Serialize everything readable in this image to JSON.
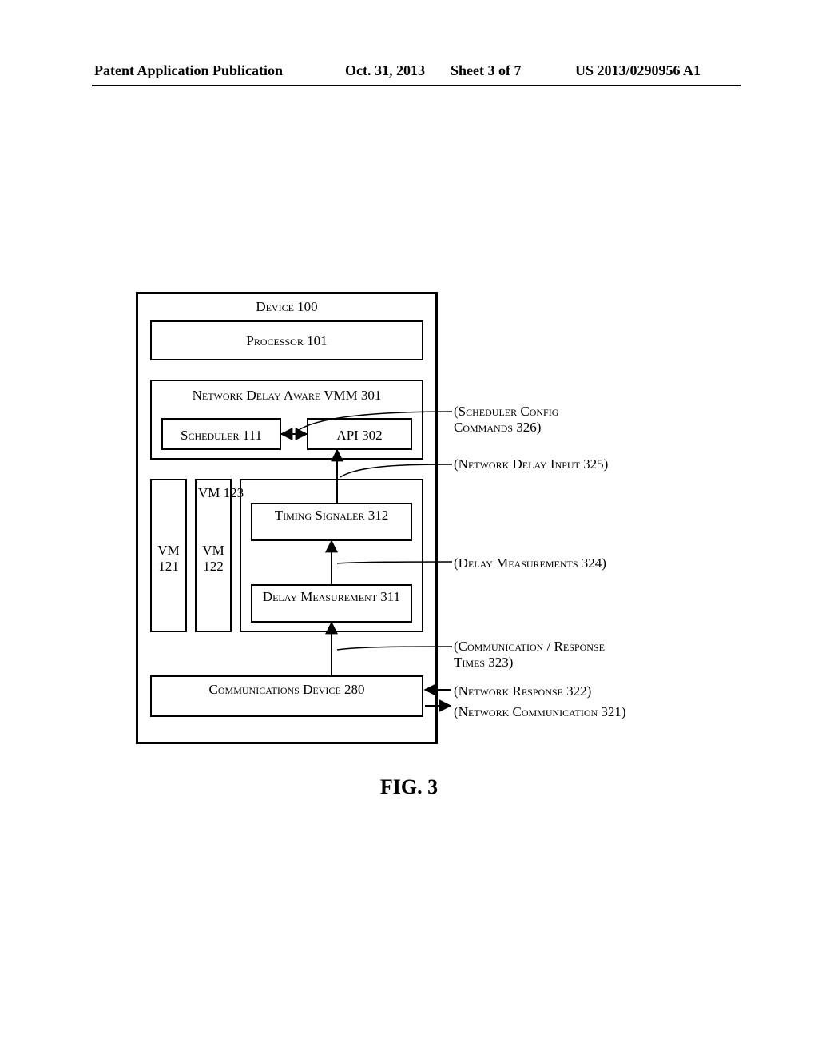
{
  "header": {
    "publication": "Patent Application Publication",
    "date": "Oct. 31, 2013",
    "sheet": "Sheet 3 of 7",
    "pubno": "US 2013/0290956 A1"
  },
  "device": {
    "title": "Device 100",
    "processor": "Processor 101",
    "vmm": {
      "title": "Network Delay Aware VMM 301",
      "scheduler": "Scheduler 111",
      "api": "API 302"
    },
    "vms": {
      "vm121": "VM 121",
      "vm122": "VM 122",
      "vm123": {
        "title": "VM 123",
        "signaler": "Timing Signaler 312",
        "measurement": "Delay Measurement 311"
      }
    },
    "comm": "Communications Device 280"
  },
  "annotations": {
    "a326": "(Scheduler Config Commands 326)",
    "a325": "(Network Delay Input 325)",
    "a324": "(Delay Measurements 324)",
    "a323": "(Communication / Response Times 323)",
    "a322": "(Network Response 322)",
    "a321": "(Network Communication 321)"
  },
  "figure": "FIG. 3"
}
